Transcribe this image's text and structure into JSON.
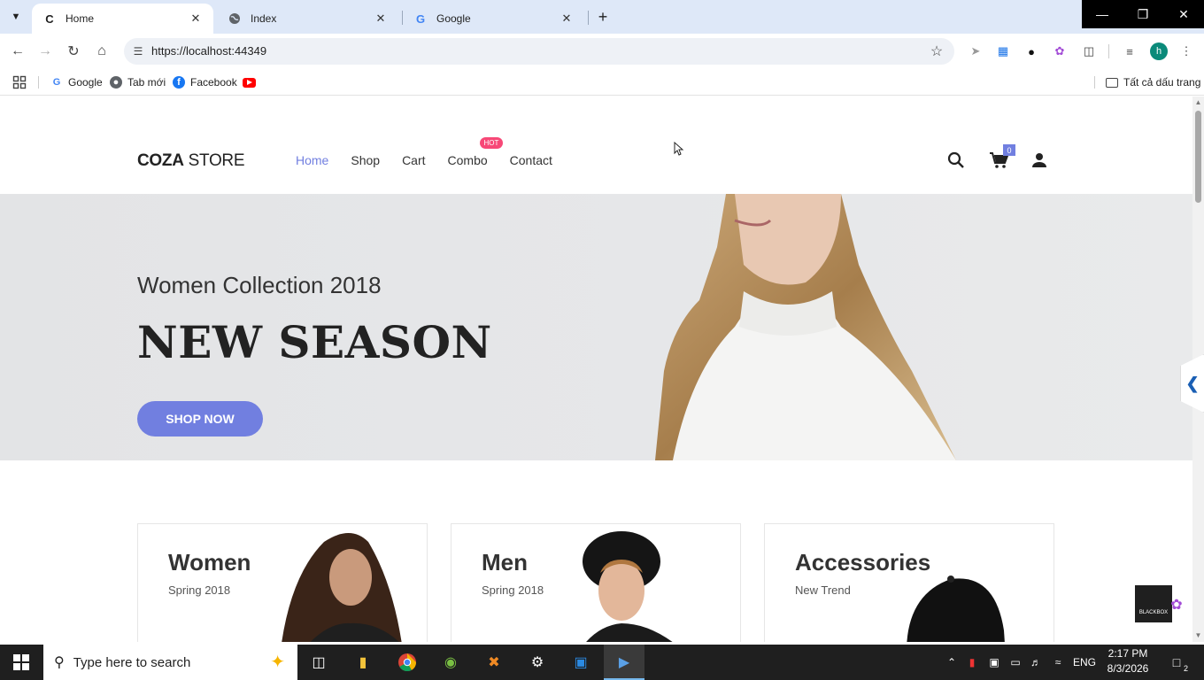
{
  "browser": {
    "tabs": [
      {
        "title": "Home",
        "favicon": "C",
        "active": true
      },
      {
        "title": "Index",
        "favicon": "globe",
        "active": false
      },
      {
        "title": "Google",
        "favicon": "G",
        "active": false
      }
    ],
    "url": "https://localhost:44349",
    "bookmarks": [
      {
        "label": "Google",
        "icon": "G"
      },
      {
        "label": "Tab mới",
        "icon": "globe"
      },
      {
        "label": "Facebook",
        "icon": "f"
      },
      {
        "label": "",
        "icon": "youtube"
      }
    ],
    "all_bookmarks_label": "Tất cả dấu trang",
    "profile_initial": "h"
  },
  "site": {
    "logo_bold": "COZA",
    "logo_light": " STORE",
    "nav": [
      {
        "label": "Home",
        "active": true
      },
      {
        "label": "Shop",
        "active": false
      },
      {
        "label": "Cart",
        "active": false
      },
      {
        "label": "Combo",
        "active": false
      },
      {
        "label": "Contact",
        "active": false
      }
    ],
    "hot_badge": "HOT",
    "cart_count": "0",
    "accent_color": "#717fe0"
  },
  "hero": {
    "subtitle": "Women Collection 2018",
    "title": "NEW SEASON",
    "button": "SHOP NOW"
  },
  "banners": [
    {
      "title": "Women",
      "subtitle": "Spring 2018"
    },
    {
      "title": "Men",
      "subtitle": "Spring 2018"
    },
    {
      "title": "Accessories",
      "subtitle": "New Trend"
    }
  ],
  "taskbar": {
    "search_placeholder": "Type here to search",
    "language": "ENG",
    "time": "2:17 PM",
    "date": "8/3/2026",
    "notification_count": "2"
  },
  "float_badge_text": "BLACKBOX"
}
